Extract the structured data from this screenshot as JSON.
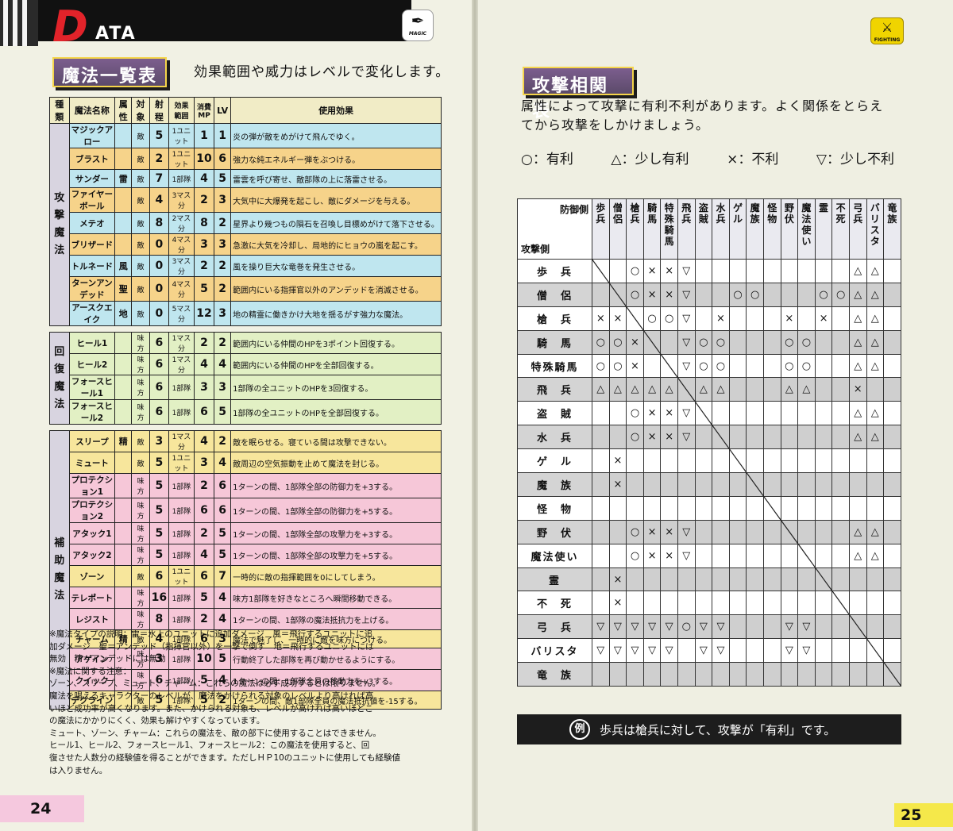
{
  "header": {
    "logo_d": "D",
    "logo_rest": "ATA",
    "magic_badge": "MAGIC",
    "fighting_badge": "FIGHTING"
  },
  "magic": {
    "title": "魔法一覧表",
    "subtitle": "効果範囲や威力はレベルで変化します。",
    "headers": [
      "種類",
      "魔法名称",
      "属性",
      "対象",
      "射程",
      "効果範囲",
      "消費MP",
      "LV",
      "使用効果"
    ],
    "groups": [
      {
        "category": "攻撃魔法",
        "rows": [
          {
            "name": "マジックアロー",
            "attr": "",
            "target": "敵",
            "range": "5",
            "area": "1ユニット",
            "mp": "1",
            "lv": "1",
            "effect": "炎の弾が敵をめがけて飛んでゆく。",
            "color": "#bfe6ef"
          },
          {
            "name": "ブラスト",
            "attr": "",
            "target": "敵",
            "range": "2",
            "area": "1ユニット",
            "mp": "10",
            "lv": "6",
            "effect": "強力な純エネルギー弾をぶつける。",
            "color": "#f6d38a"
          },
          {
            "name": "サンダー",
            "attr": "雷",
            "target": "敵",
            "range": "7",
            "area": "1部隊",
            "mp": "4",
            "lv": "5",
            "effect": "雷雲を呼び寄せ、敵部隊の上に落雷させる。",
            "color": "#bfe6ef"
          },
          {
            "name": "ファイヤーボール",
            "attr": "",
            "target": "敵",
            "range": "4",
            "area": "3マス分",
            "mp": "2",
            "lv": "3",
            "effect": "大気中に大爆発を起こし、敵にダメージを与える。",
            "color": "#f6d38a"
          },
          {
            "name": "メテオ",
            "attr": "",
            "target": "敵",
            "range": "8",
            "area": "2マス分",
            "mp": "8",
            "lv": "2",
            "effect": "星界より幾つもの隕石を召喚し目標めがけて落下させる。",
            "color": "#bfe6ef"
          },
          {
            "name": "ブリザード",
            "attr": "",
            "target": "敵",
            "range": "0",
            "area": "4マス分",
            "mp": "3",
            "lv": "3",
            "effect": "急激に大気を冷却し、局地的にヒョウの嵐を起こす。",
            "color": "#f6d38a"
          },
          {
            "name": "トルネード",
            "attr": "風",
            "target": "敵",
            "range": "0",
            "area": "3マス分",
            "mp": "2",
            "lv": "2",
            "effect": "風を操り巨大な竜巻を発生させる。",
            "color": "#bfe6ef"
          },
          {
            "name": "ターンアンデッド",
            "attr": "聖",
            "target": "敵",
            "range": "0",
            "area": "4マス分",
            "mp": "5",
            "lv": "2",
            "effect": "範囲内にいる指揮官以外のアンデッドを消滅させる。",
            "color": "#f6d38a"
          },
          {
            "name": "アースクエイク",
            "attr": "地",
            "target": "敵",
            "range": "0",
            "area": "5マス分",
            "mp": "12",
            "lv": "3",
            "effect": "地の精霊に働きかけ大地を揺るがす強力な魔法。",
            "color": "#bfe6ef"
          }
        ]
      },
      {
        "category": "回復魔法",
        "rows": [
          {
            "name": "ヒール1",
            "attr": "",
            "target": "味方",
            "range": "6",
            "area": "1マス分",
            "mp": "2",
            "lv": "2",
            "effect": "範囲内にいる仲間のHPを3ポイント回復する。",
            "color": "#e2f0c4"
          },
          {
            "name": "ヒール2",
            "attr": "",
            "target": "味方",
            "range": "6",
            "area": "1マス分",
            "mp": "4",
            "lv": "4",
            "effect": "範囲内にいる仲間のHPを全部回復する。",
            "color": "#e2f0c4"
          },
          {
            "name": "フォースヒール1",
            "attr": "",
            "target": "味方",
            "range": "6",
            "area": "1部隊",
            "mp": "3",
            "lv": "3",
            "effect": "1部隊の全ユニットのHPを3回復する。",
            "color": "#e2f0c4"
          },
          {
            "name": "フォースヒール2",
            "attr": "",
            "target": "味方",
            "range": "6",
            "area": "1部隊",
            "mp": "6",
            "lv": "5",
            "effect": "1部隊の全ユニットのHPを全部回復する。",
            "color": "#e2f0c4"
          }
        ]
      },
      {
        "category": "補助魔法",
        "rows": [
          {
            "name": "スリープ",
            "attr": "精",
            "target": "敵",
            "range": "3",
            "area": "1マス分",
            "mp": "4",
            "lv": "2",
            "effect": "敵を眠らせる。寝ている間は攻撃できない。",
            "color": "#f7e69c"
          },
          {
            "name": "ミュート",
            "attr": "",
            "target": "敵",
            "range": "5",
            "area": "1ユニット",
            "mp": "3",
            "lv": "4",
            "effect": "敵周辺の空気振動を止めて魔法を封じる。",
            "color": "#f7e69c"
          },
          {
            "name": "プロテクション1",
            "attr": "",
            "target": "味方",
            "range": "5",
            "area": "1部隊",
            "mp": "2",
            "lv": "6",
            "effect": "1ターンの間、1部隊全部の防御力を+3する。",
            "color": "#f6c7d8"
          },
          {
            "name": "プロテクション2",
            "attr": "",
            "target": "味方",
            "range": "5",
            "area": "1部隊",
            "mp": "6",
            "lv": "6",
            "effect": "1ターンの間、1部隊全部の防御力を+5する。",
            "color": "#f6c7d8"
          },
          {
            "name": "アタック1",
            "attr": "",
            "target": "味方",
            "range": "5",
            "area": "1部隊",
            "mp": "2",
            "lv": "5",
            "effect": "1ターンの間、1部隊全部の攻撃力を+3する。",
            "color": "#f6c7d8"
          },
          {
            "name": "アタック2",
            "attr": "",
            "target": "味方",
            "range": "5",
            "area": "1部隊",
            "mp": "4",
            "lv": "5",
            "effect": "1ターンの間、1部隊全部の攻撃力を+5する。",
            "color": "#f6c7d8"
          },
          {
            "name": "ゾーン",
            "attr": "",
            "target": "敵",
            "range": "6",
            "area": "1ユニット",
            "mp": "6",
            "lv": "7",
            "effect": "一時的に敵の指揮範囲を0にしてしまう。",
            "color": "#f7e69c"
          },
          {
            "name": "テレポート",
            "attr": "",
            "target": "味方",
            "range": "16",
            "area": "1部隊",
            "mp": "5",
            "lv": "4",
            "effect": "味方1部隊を好きなところへ瞬間移動できる。",
            "color": "#f6c7d8"
          },
          {
            "name": "レジスト",
            "attr": "",
            "target": "味方",
            "range": "8",
            "area": "1部隊",
            "mp": "2",
            "lv": "4",
            "effect": "1ターンの間、1部隊の魔法抵抗力を上げる。",
            "color": "#f6c7d8"
          },
          {
            "name": "チャーム",
            "attr": "精",
            "target": "敵",
            "range": "4",
            "area": "1部隊",
            "mp": "6",
            "lv": "3",
            "effect": "魔法で魅了し、一時的に敵を味方につける。",
            "color": "#f7e69c"
          },
          {
            "name": "アゲイン",
            "attr": "",
            "target": "味方",
            "range": "3",
            "area": "1部隊",
            "mp": "10",
            "lv": "5",
            "effect": "行動終了した部隊を再び動かせるようにする。",
            "color": "#f6c7d8"
          },
          {
            "name": "クイック",
            "attr": "",
            "target": "味方",
            "range": "6",
            "area": "1部隊",
            "mp": "5",
            "lv": "4",
            "effect": "1ターンの間、1部隊全員の移動力を+3する。",
            "color": "#f6c7d8"
          },
          {
            "name": "デクライン",
            "attr": "",
            "target": "敵",
            "range": "5",
            "area": "1部隊",
            "mp": "5",
            "lv": "2",
            "effect": "1ターンの間、敵1部隊全員の魔法抵抗値を-15する。",
            "color": "#f7e69c"
          }
        ]
      }
    ],
    "notes": [
      "※魔法タイプの説明：雷＝水上のユニットに追加ダメージ　風＝飛行するユニットに追",
      "加ダメージ　聖＝アンデッド（指揮官以外）を一撃で倒す　地＝飛行するユニットには",
      "無効　精＝アンデッドには無効",
      "※魔法に関する注意：",
      "ゾーン、スリープ、ミュート、チャーム：これらの魔法は必ず成功するとは限りません。",
      "魔法を唱えるキャラクターのレベルが、魔法をかけられる対象のレベルより高ければ高",
      "いほど成功率が高くなります。また、かけられる対象も、レベルが高ければ高いほどこ",
      "の魔法にかかりにくく、効果も解けやすくなっています。",
      "ミュート、ゾーン、チャーム：これらの魔法を、敵の部下に使用することはできません。",
      "ヒール1、ヒール2、フォースヒール1、フォースヒール2：この魔法を使用すると、回",
      "復させた人数分の経験値を得ることができます。ただしＨＰ10のユニットに使用しても経験値",
      "は入りません。"
    ],
    "page_number": "24"
  },
  "attack": {
    "title": "攻撃相関表",
    "intro_line1": "属性によって攻撃に有利不利があります。よく関係をとらえ",
    "intro_line2": "てから攻撃をしかけましょう。",
    "legend": [
      "○：有利",
      "△：少し有利",
      "×：不利",
      "▽：少し不利"
    ],
    "corner_defense": "防御側",
    "corner_attack": "攻撃側",
    "columns": [
      "歩兵",
      "僧侶",
      "槍兵",
      "騎馬",
      "特殊騎馬",
      "飛兵",
      "盗賊",
      "水兵",
      "ゲル",
      "魔族",
      "怪物",
      "野伏",
      "魔法使い",
      "霊",
      "不死",
      "弓兵",
      "バリスタ",
      "竜族"
    ],
    "rows": [
      {
        "label": "歩　兵",
        "shade": "light",
        "cells": [
          "",
          "",
          "○",
          "×",
          "×",
          "▽",
          "",
          "",
          "",
          "",
          "",
          "",
          "",
          "",
          "",
          "△",
          "△",
          ""
        ]
      },
      {
        "label": "僧　侶",
        "shade": "dark",
        "cells": [
          "",
          "",
          "○",
          "×",
          "×",
          "▽",
          "",
          "",
          "○",
          "○",
          "",
          "",
          "",
          "○",
          "○",
          "△",
          "△",
          ""
        ]
      },
      {
        "label": "槍　兵",
        "shade": "light",
        "cells": [
          "×",
          "×",
          "",
          "○",
          "○",
          "▽",
          "",
          "×",
          "",
          "",
          "",
          "×",
          "",
          "×",
          "",
          "△",
          "△",
          ""
        ]
      },
      {
        "label": "騎　馬",
        "shade": "dark",
        "cells": [
          "○",
          "○",
          "×",
          "",
          "",
          "▽",
          "○",
          "○",
          "",
          "",
          "",
          "○",
          "○",
          "",
          "",
          "△",
          "△",
          ""
        ]
      },
      {
        "label": "特殊騎馬",
        "shade": "light",
        "cells": [
          "○",
          "○",
          "×",
          "",
          "",
          "▽",
          "○",
          "○",
          "",
          "",
          "",
          "○",
          "○",
          "",
          "",
          "△",
          "△",
          ""
        ]
      },
      {
        "label": "飛　兵",
        "shade": "dark",
        "cells": [
          "△",
          "△",
          "△",
          "△",
          "△",
          "",
          "△",
          "△",
          "",
          "",
          "",
          "△",
          "△",
          "",
          "",
          "×",
          "",
          ""
        ]
      },
      {
        "label": "盗　賊",
        "shade": "light",
        "cells": [
          "",
          "",
          "○",
          "×",
          "×",
          "▽",
          "",
          "",
          "",
          "",
          "",
          "",
          "",
          "",
          "",
          "△",
          "△",
          ""
        ]
      },
      {
        "label": "水　兵",
        "shade": "dark",
        "cells": [
          "",
          "",
          "○",
          "×",
          "×",
          "▽",
          "",
          "",
          "",
          "",
          "",
          "",
          "",
          "",
          "",
          "△",
          "△",
          ""
        ]
      },
      {
        "label": "ゲ　ル",
        "shade": "light",
        "cells": [
          "",
          "×",
          "",
          "",
          "",
          "",
          "",
          "",
          "",
          "",
          "",
          "",
          "",
          "",
          "",
          "",
          "",
          ""
        ]
      },
      {
        "label": "魔　族",
        "shade": "dark",
        "cells": [
          "",
          "×",
          "",
          "",
          "",
          "",
          "",
          "",
          "",
          "",
          "",
          "",
          "",
          "",
          "",
          "",
          "",
          ""
        ]
      },
      {
        "label": "怪　物",
        "shade": "light",
        "cells": [
          "",
          "",
          "",
          "",
          "",
          "",
          "",
          "",
          "",
          "",
          "",
          "",
          "",
          "",
          "",
          "",
          "",
          ""
        ]
      },
      {
        "label": "野　伏",
        "shade": "dark",
        "cells": [
          "",
          "",
          "○",
          "×",
          "×",
          "▽",
          "",
          "",
          "",
          "",
          "",
          "",
          "",
          "",
          "",
          "△",
          "△",
          ""
        ]
      },
      {
        "label": "魔法使い",
        "shade": "light",
        "cells": [
          "",
          "",
          "○",
          "×",
          "×",
          "▽",
          "",
          "",
          "",
          "",
          "",
          "",
          "",
          "",
          "",
          "△",
          "△",
          ""
        ]
      },
      {
        "label": "霊",
        "shade": "dark",
        "cells": [
          "",
          "×",
          "",
          "",
          "",
          "",
          "",
          "",
          "",
          "",
          "",
          "",
          "",
          "",
          "",
          "",
          "",
          ""
        ]
      },
      {
        "label": "不　死",
        "shade": "light",
        "cells": [
          "",
          "×",
          "",
          "",
          "",
          "",
          "",
          "",
          "",
          "",
          "",
          "",
          "",
          "",
          "",
          "",
          "",
          ""
        ]
      },
      {
        "label": "弓　兵",
        "shade": "dark",
        "cells": [
          "▽",
          "▽",
          "▽",
          "▽",
          "▽",
          "○",
          "▽",
          "▽",
          "",
          "",
          "",
          "▽",
          "▽",
          "",
          "",
          "",
          "",
          ""
        ]
      },
      {
        "label": "バリスタ",
        "shade": "light",
        "cells": [
          "▽",
          "▽",
          "▽",
          "▽",
          "▽",
          "",
          "▽",
          "▽",
          "",
          "",
          "",
          "▽",
          "▽",
          "",
          "",
          "",
          "",
          ""
        ]
      },
      {
        "label": "竜　族",
        "shade": "dark",
        "cells": [
          "",
          "",
          "",
          "",
          "",
          "",
          "",
          "",
          "",
          "",
          "",
          "",
          "",
          "",
          "",
          "",
          "",
          ""
        ]
      }
    ],
    "example_mark": "例",
    "example_text": "歩兵は槍兵に対して、攻撃が「有利」です。",
    "page_number": "25"
  }
}
